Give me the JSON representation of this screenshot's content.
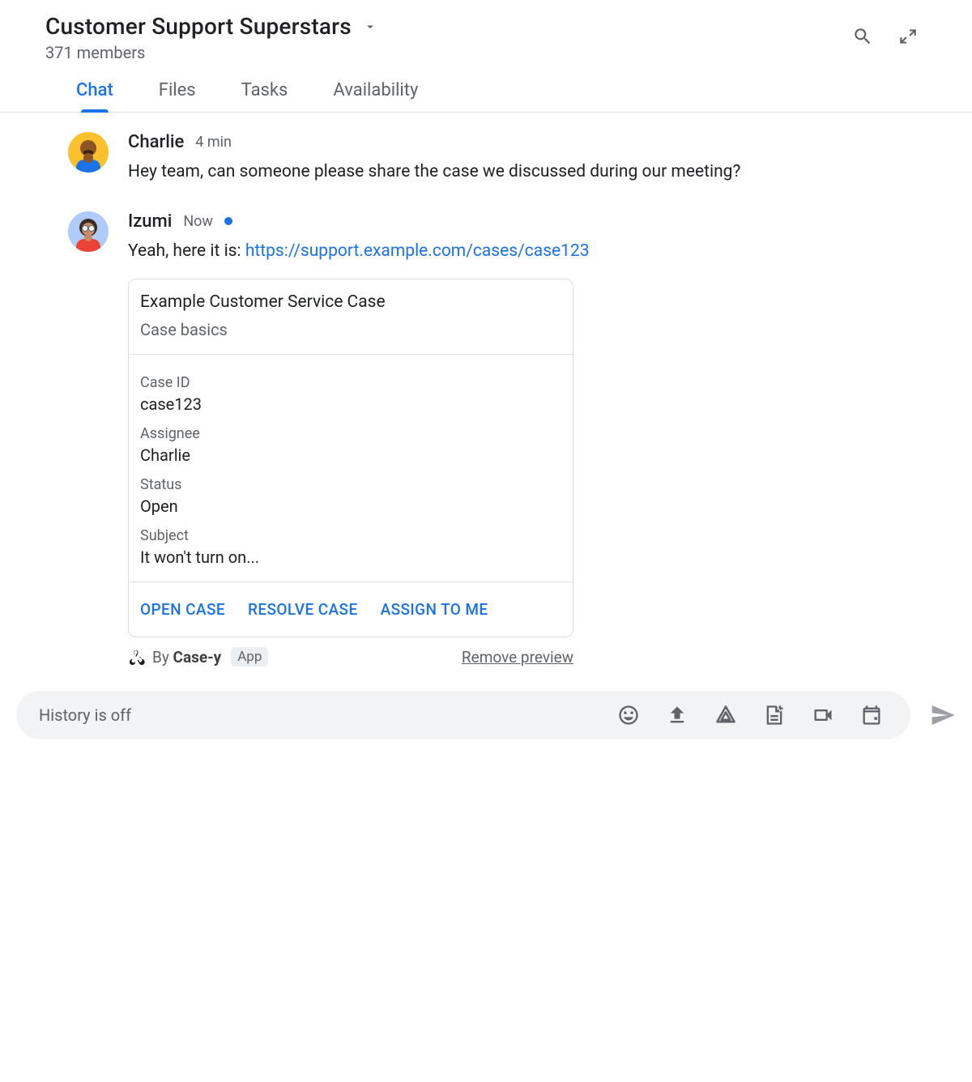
{
  "header": {
    "title": "Customer Support Superstars",
    "members": "371 members"
  },
  "tabs": [
    "Chat",
    "Files",
    "Tasks",
    "Availability"
  ],
  "messages": [
    {
      "sender": "Charlie",
      "timestamp": "4 min",
      "text": "Hey team, can someone please share the case we discussed during our meeting?"
    },
    {
      "sender": "Izumi",
      "timestamp": "Now",
      "text_prefix": "Yeah, here it is: ",
      "link": "https://support.example.com/cases/case123"
    }
  ],
  "card": {
    "title": "Example Customer Service Case",
    "subtitle": "Case basics",
    "fields": [
      {
        "label": "Case ID",
        "value": "case123"
      },
      {
        "label": "Assignee",
        "value": "Charlie"
      },
      {
        "label": "Status",
        "value": "Open"
      },
      {
        "label": "Subject",
        "value": "It won't turn on..."
      }
    ],
    "actions": [
      "OPEN CASE",
      "RESOLVE CASE",
      "ASSIGN TO ME"
    ]
  },
  "preview_footer": {
    "by": "By ",
    "app": "Case-y",
    "chip": "App",
    "remove": "Remove preview"
  },
  "composer": {
    "placeholder": "History is off"
  }
}
